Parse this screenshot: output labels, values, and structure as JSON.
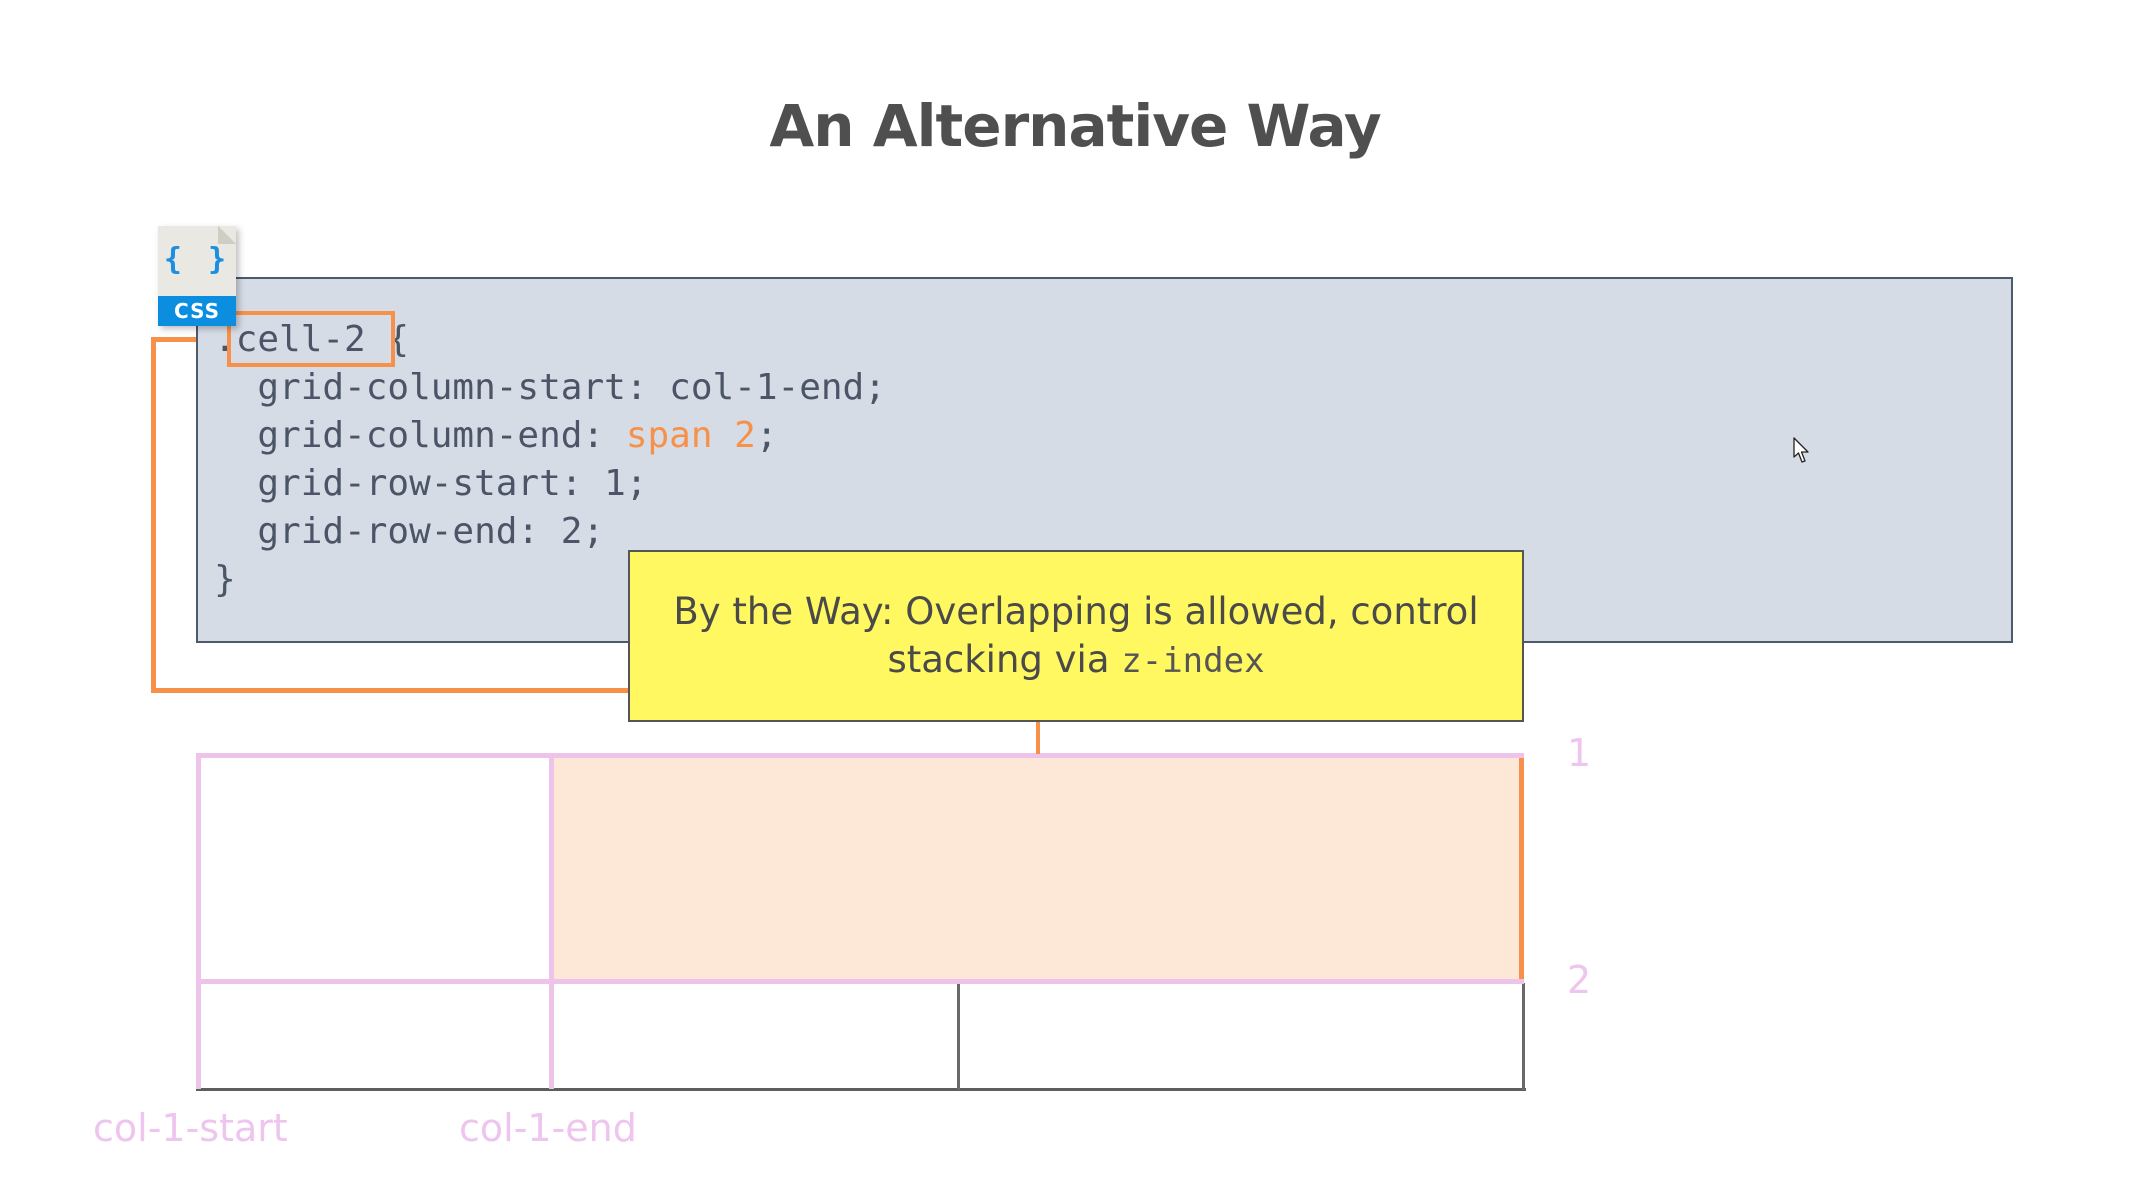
{
  "slide": {
    "title": "An Alternative Way"
  },
  "code_block": {
    "file_badge": {
      "icon": "css-file-icon",
      "glyph": "{ }",
      "label": "CSS"
    },
    "lines": [
      {
        "prefix": ".",
        "selector": "cell-2",
        "suffix": " {"
      },
      {
        "text": "  grid-column-start: col-1-end;"
      },
      {
        "property": "  grid-column-end: ",
        "value": "span 2",
        "end": ";"
      },
      {
        "text": "  grid-row-start: 1;"
      },
      {
        "text": "  grid-row-end: 2;"
      },
      {
        "text": "}"
      }
    ]
  },
  "callout": {
    "text": "By the Way: Overlapping is allowed, control stacking via ",
    "code": "z-index"
  },
  "grid_diagram": {
    "highlighted_cell": "cell-2",
    "column_labels": [
      "col-1-start",
      "col-1-end"
    ],
    "row_labels": [
      "1",
      "2"
    ]
  },
  "colors": {
    "accent_orange": "#f7914a",
    "grid_line_pink": "#edc3ea",
    "callout_yellow": "#fff861",
    "code_background": "#d5dce6",
    "highlight_fill": "#fde8d8"
  }
}
